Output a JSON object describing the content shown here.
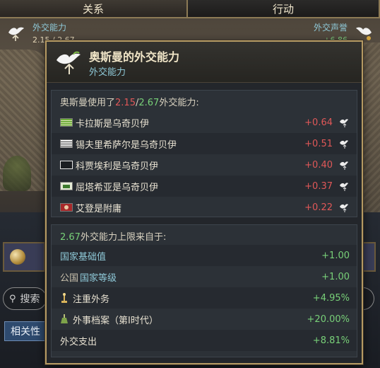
{
  "tabs": [
    "关系",
    "行动"
  ],
  "header_left": {
    "label": "外交能力",
    "value": "2.15 / 2.67"
  },
  "header_right": {
    "label": "外交声誉",
    "value": "+6.86"
  },
  "background": {
    "search_placeholder": "搜索",
    "relevance_button": "相关性"
  },
  "tooltip": {
    "title": "奥斯曼的外交能力",
    "subtitle": "外交能力",
    "used_prefix": "奥斯曼使用了",
    "used_value": "2.15",
    "used_sep": "/",
    "used_max": "2.67",
    "used_suffix": "外交能力:",
    "relations": [
      {
        "name": "卡拉斯是乌奇贝伊",
        "value": "+0.64",
        "flag": "lines"
      },
      {
        "name": "锡夫里希萨尔是乌奇贝伊",
        "value": "+0.51",
        "flag": "white"
      },
      {
        "name": "科贾埃利是乌奇贝伊",
        "value": "+0.40",
        "flag": "hollow"
      },
      {
        "name": "屈塔希亚是乌奇贝伊",
        "value": "+0.37",
        "flag": "green"
      },
      {
        "name": "艾登是附庸",
        "value": "+0.22",
        "flag": "red"
      }
    ],
    "limit_value": "2.67",
    "limit_suffix": "外交能力上限来自于:",
    "sources": [
      {
        "name": "国家基础值",
        "value": "+1.00",
        "style": "blue"
      },
      {
        "name_a": "公国",
        "name_b": "国家等级",
        "value": "+1.00",
        "style": "mixed"
      },
      {
        "name": "注重外务",
        "value": "+4.95%",
        "style": "plain",
        "icon": "rank-icon"
      },
      {
        "name": "外事档案（第Ⅰ时代）",
        "value": "+20.00%",
        "style": "plain",
        "icon": "flask-icon"
      },
      {
        "name": "外交支出",
        "value": "+8.81%",
        "style": "plain"
      }
    ]
  },
  "colors": {
    "negative": "#e05858",
    "positive": "#78d078",
    "link": "#8fc9d8",
    "border": "#b59a63"
  }
}
